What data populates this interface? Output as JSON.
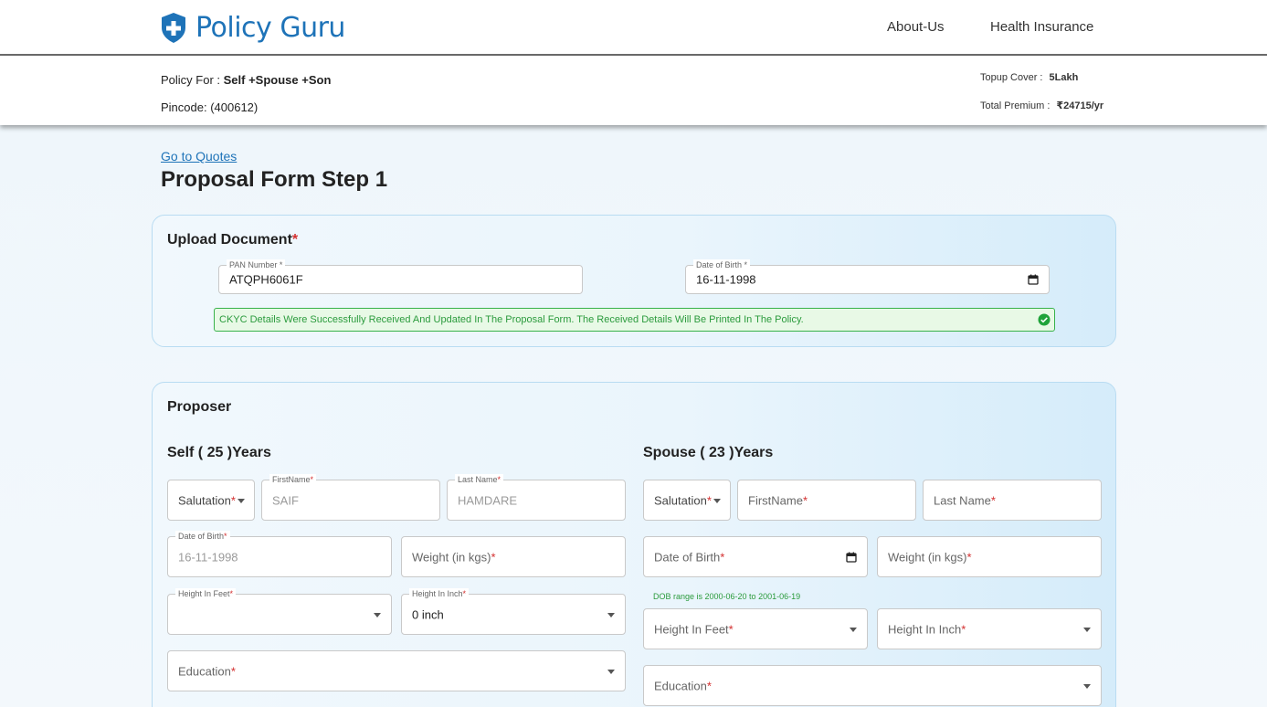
{
  "brand": {
    "name": "Policy Guru",
    "shield_color": "#1e73b8"
  },
  "nav": {
    "about": "About-Us",
    "health": "Health Insurance"
  },
  "summary": {
    "policy_for_label": "Policy For :",
    "policy_for_value": "Self +Spouse +Son",
    "pincode": "Pincode: (400612)",
    "topup_label": "Topup Cover :",
    "topup_value": "5Lakh",
    "premium_label": "Total Premium :",
    "premium_value": "₹24715/yr"
  },
  "links": {
    "go_to_quotes": "Go to Quotes"
  },
  "page": {
    "title": "Proposal Form Step 1"
  },
  "upload": {
    "title": "Upload Document",
    "required_mark": "*",
    "pan_label": "PAN Number *",
    "pan_value": "ATQPH6061F",
    "dob_label": "Date of Birth *",
    "dob_value": "16-11-1998",
    "success_text": "CKYC Details Were Successfully Received And Updated In The Proposal Form. The Received Details Will Be Printed In The Policy.",
    "success_color": "#38b24a"
  },
  "proposer": {
    "title": "Proposer",
    "self": {
      "heading": "Self ( 25 )Years",
      "salutation": "Salutation",
      "firstname_label": "FirstName",
      "firstname_value": "SAIF",
      "lastname_label": "Last Name",
      "lastname_value": "HAMDARE",
      "dob_label": "Date of Birth",
      "dob_value": "16-11-1998",
      "weight": "Weight (in kgs)",
      "height_feet_label": "Height In Feet",
      "height_inch_label": "Height In Inch",
      "height_inch_value": "0 inch",
      "education": "Education"
    },
    "spouse": {
      "heading": "Spouse ( 23 )Years",
      "salutation": "Salutation",
      "firstname": "FirstName",
      "lastname": "Last Name",
      "dob": "Date of Birth",
      "weight": "Weight (in kgs)",
      "dob_hint": "DOB range is 2000-06-20 to 2001-06-19",
      "height_feet": "Height In Feet",
      "height_inch": "Height In Inch",
      "education": "Education"
    },
    "required_mark": "*"
  }
}
